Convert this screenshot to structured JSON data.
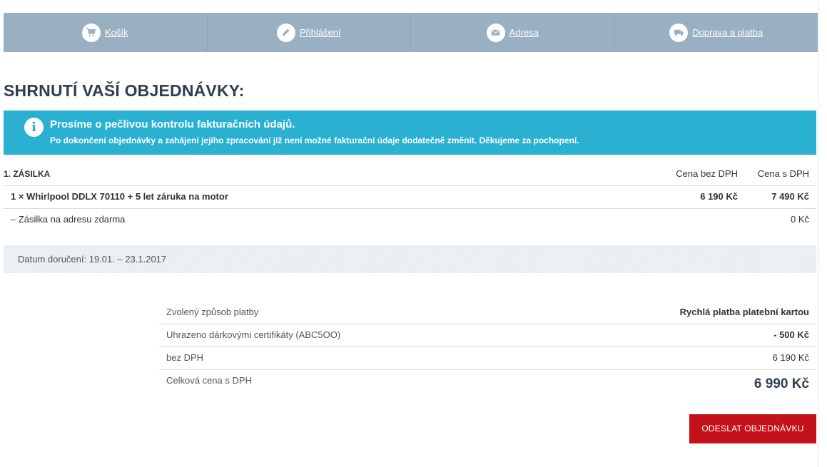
{
  "steps": [
    {
      "label": "Košík",
      "icon": "cart-icon"
    },
    {
      "label": "Přihlášení",
      "icon": "pencil-icon"
    },
    {
      "label": "Adresa",
      "icon": "envelope-icon"
    },
    {
      "label": "Doprava a platba",
      "icon": "truck-icon"
    }
  ],
  "page_title": "SHRNUTÍ VAŠÍ OBJEDNÁVKY:",
  "info": {
    "title": "Prosíme o pečlivou kontrolu fakturačních údajů.",
    "text": "Po dokončení objednávky a zahájení jejího zpracování již není možné fakturační údaje dodatečně změnit. Děkujeme za pochopení."
  },
  "shipment": {
    "title": "1. ZÁSILKA",
    "col_ex_vat": "Cena bez DPH",
    "col_inc_vat": "Cena s DPH",
    "items": [
      {
        "name": "1 × Whirlpool DDLX 70110 + 5 let záruka na motor",
        "price_ex": "6 190 Kč",
        "price_inc": "7 490 Kč"
      },
      {
        "name": "– Zásilka na adresu zdarma",
        "price_ex": "",
        "price_inc": "0 Kč"
      }
    ],
    "delivery": "Datum doručení: 19.01. – 23.1.2017"
  },
  "summary": {
    "payment_label": "Zvolený způsob platby",
    "payment_value": "Rychlá platba platební kartou",
    "voucher_label": "Uhrazeno dárkovými certifikáty (ABC5OO)",
    "voucher_value": "- 500 Kč",
    "ex_vat_label": "bez DPH",
    "ex_vat_value": "6 190 Kč",
    "total_label": "Celková cena s DPH",
    "total_value": "6 990 Kč"
  },
  "submit_label": "ODESLAT OBJEDNÁVKU",
  "colors": {
    "steps_bg": "#98b0c1",
    "info_bg": "#2ab1d1",
    "submit_bg": "#c4121a"
  }
}
